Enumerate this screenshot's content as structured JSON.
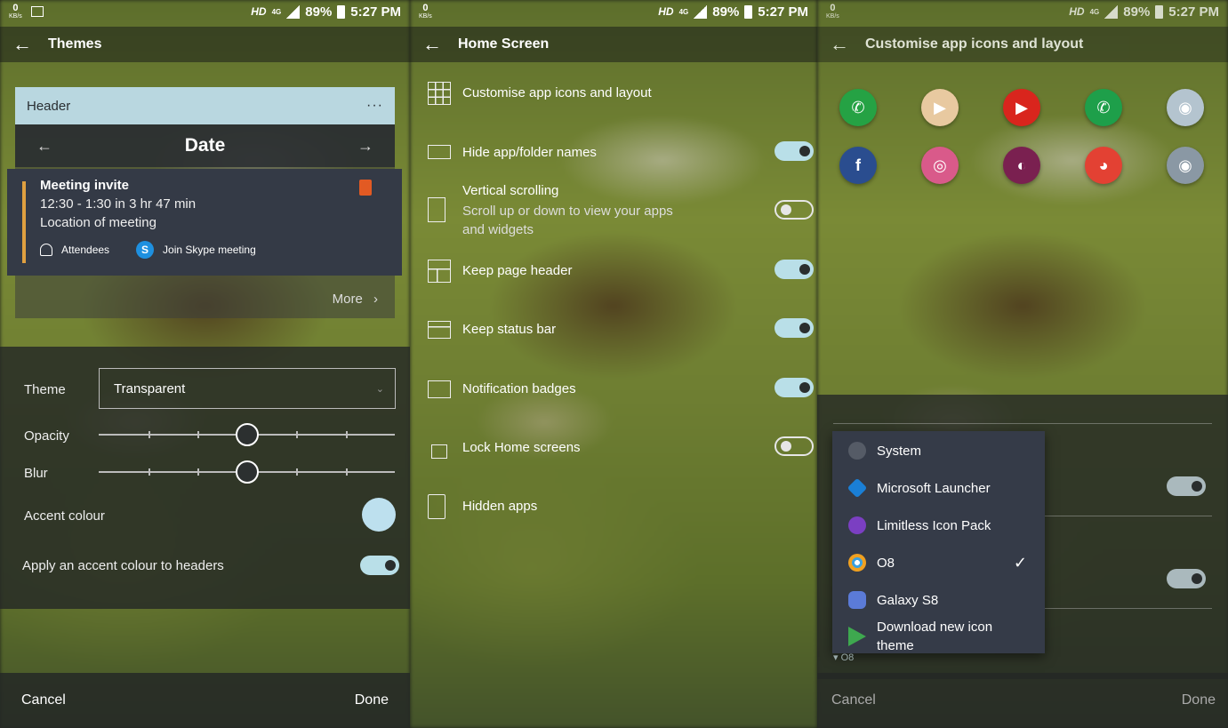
{
  "status": {
    "left_speed": "0",
    "left_unit": "KB/s",
    "hd": "HD",
    "net": "4G",
    "battery": "89%",
    "time": "5:27 PM"
  },
  "themes": {
    "title": "Themes",
    "card_header": "Header",
    "card_more_dots": "···",
    "date_label": "Date",
    "meeting_title": "Meeting invite",
    "meeting_time": "12:30 - 1:30 in 3 hr 47 min",
    "meeting_location": "Location of meeting",
    "attendees": "Attendees",
    "skype": "Join Skype meeting",
    "more": "More",
    "theme_label": "Theme",
    "theme_value": "Transparent",
    "opacity_label": "Opacity",
    "opacity_value": 0.5,
    "blur_label": "Blur",
    "blur_value": 0.5,
    "accent_label": "Accent colour",
    "accent_color": "#bde0ee",
    "apply_accent_label": "Apply an accent colour to headers",
    "apply_accent_on": true,
    "cancel": "Cancel",
    "done": "Done"
  },
  "home": {
    "title": "Home Screen",
    "items": [
      {
        "label": "Customise app icons and layout",
        "icon": "grid-icon"
      },
      {
        "label": "Hide app/folder names",
        "icon": "label-icon",
        "toggle": true
      },
      {
        "label": "Vertical scrolling",
        "sub": "Scroll up or down to view your apps and widgets",
        "icon": "vertical-layout-icon",
        "toggle": false
      },
      {
        "label": "Keep page header",
        "icon": "header-layout-icon",
        "toggle": true
      },
      {
        "label": "Keep status bar",
        "icon": "statusbar-icon",
        "toggle": true
      },
      {
        "label": "Notification badges",
        "icon": "badge-icon",
        "toggle": true
      },
      {
        "label": "Lock Home screens",
        "icon": "lock-icon",
        "toggle": false
      },
      {
        "label": "Hidden apps",
        "icon": "hidden-apps-icon"
      }
    ]
  },
  "customise": {
    "title": "Customise app icons and layout",
    "apps": [
      {
        "name": "whatsapp-icon",
        "color": "#25a244"
      },
      {
        "name": "google-play-music-icon",
        "color": "#e8c9a0"
      },
      {
        "name": "youtube-icon",
        "color": "#d9251d"
      },
      {
        "name": "phone-icon",
        "color": "#1e9f4a"
      },
      {
        "name": "camera-icon",
        "color": "#b4c4cf"
      },
      {
        "name": "facebook-icon",
        "color": "#2a4d8f"
      },
      {
        "name": "instagram-icon",
        "color": "#d95a8a"
      },
      {
        "name": "firefox-icon",
        "color": "#7a2050"
      },
      {
        "name": "chrome-icon",
        "color": "#e34133"
      },
      {
        "name": "camera-alt-icon",
        "color": "#8a98a4"
      }
    ],
    "menu": [
      {
        "label": "System",
        "icon": "gear-icon",
        "color": "#555b66"
      },
      {
        "label": "Microsoft Launcher",
        "icon": "microsoft-launcher-icon",
        "color": "#1a7fd6"
      },
      {
        "label": "Limitless Icon Pack",
        "icon": "limitless-icon",
        "color": "#7b3fc2"
      },
      {
        "label": "O8",
        "icon": "o8-icon",
        "color": "#f0a020",
        "selected": true
      },
      {
        "label": "Galaxy S8",
        "icon": "galaxy-icon",
        "color": "#5b7bd8"
      },
      {
        "label": "Download new icon theme",
        "icon": "play-store-icon",
        "color": "#3ea84f"
      }
    ],
    "selected_caption": "O8",
    "cancel": "Cancel",
    "done": "Done"
  }
}
